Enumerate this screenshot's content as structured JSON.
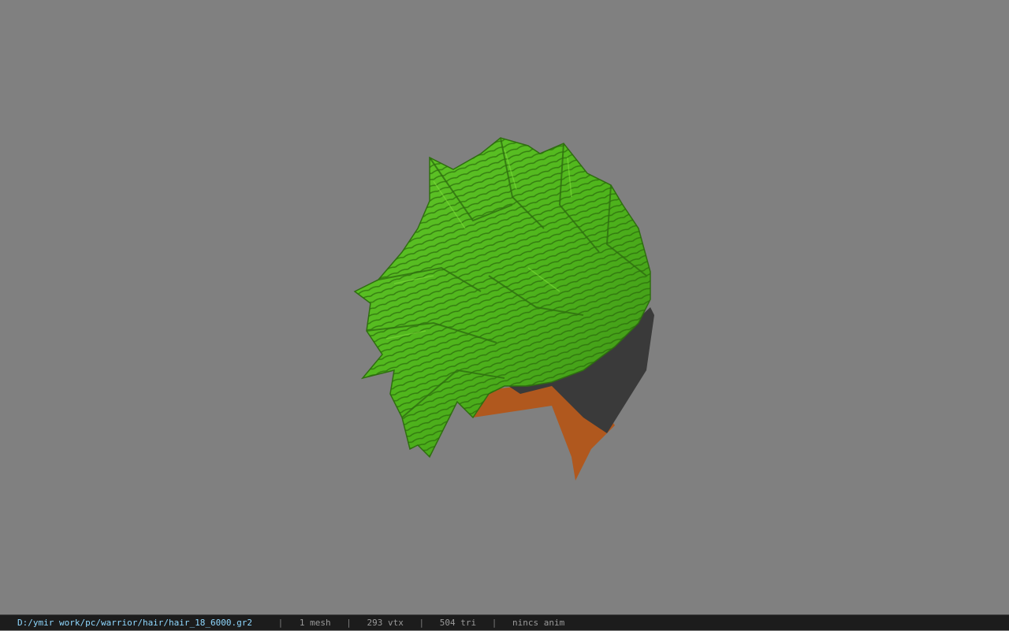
{
  "window": {
    "background_color": "#808080"
  },
  "viewport": {
    "model_icon": "hair-mesh",
    "hair_color": "#4fb51c",
    "hair_dark_color": "#2f6f10",
    "scalp_color": "#3a3a3a",
    "inner_color": "#b0581e"
  },
  "status": {
    "file_path": "D:/ymir work/pc/warrior/hair/hair_18_6000.gr2",
    "separator": "|",
    "mesh_count": "1 mesh",
    "vertex_count": "293 vtx",
    "triangle_count": "504 tri",
    "anim": "nincs anim"
  }
}
